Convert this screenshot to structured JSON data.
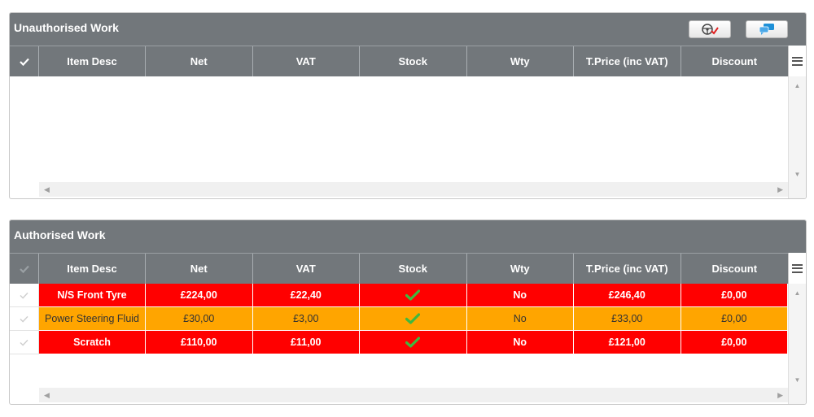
{
  "colors": {
    "header_bg": "#72777b",
    "row_red": "#ff0000",
    "row_orange": "#ffa500",
    "stock_tick": "#4caf50"
  },
  "columns": [
    "Item Desc",
    "Net",
    "VAT",
    "Stock",
    "Wty",
    "T.Price (inc VAT)",
    "Discount"
  ],
  "unauthorised": {
    "title": "Unauthorised Work",
    "buttons": [
      {
        "icon": "steering-wheel-check-icon"
      },
      {
        "icon": "comment-icon"
      }
    ],
    "rows": []
  },
  "authorised": {
    "title": "Authorised Work",
    "rows": [
      {
        "status": "red",
        "desc": "N/S Front Tyre",
        "net": "£224,00",
        "vat": "£22,40",
        "stock": "in-stock-tick-icon",
        "wty": "No",
        "tprice": "£246,40",
        "discount": "£0,00"
      },
      {
        "status": "orange",
        "desc": "Power Steering Fluid",
        "net": "£30,00",
        "vat": "£3,00",
        "stock": "in-stock-tick-icon",
        "wty": "No",
        "tprice": "£33,00",
        "discount": "£0,00"
      },
      {
        "status": "red",
        "desc": "Scratch",
        "net": "£110,00",
        "vat": "£11,00",
        "stock": "in-stock-tick-icon",
        "wty": "No",
        "tprice": "£121,00",
        "discount": "£0,00"
      }
    ]
  }
}
